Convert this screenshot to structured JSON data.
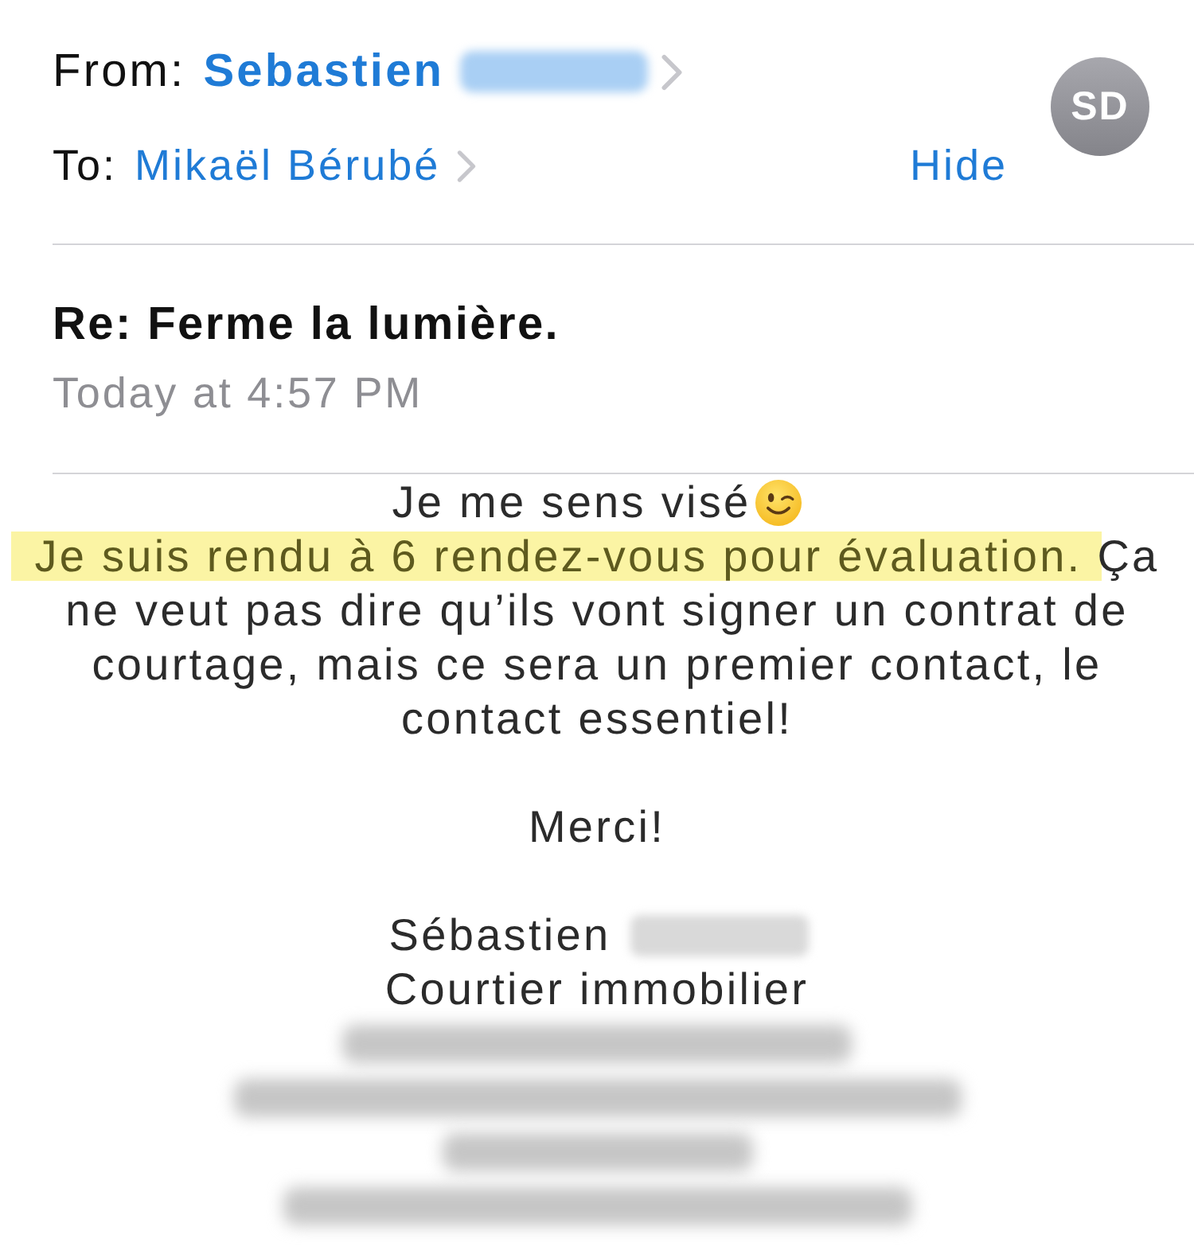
{
  "header": {
    "from": {
      "label": "From:",
      "name": "Sebastien",
      "surname_redacted": true
    },
    "to": {
      "label": "To:",
      "name": "Mikaël Bérubé"
    },
    "hide_button": "Hide",
    "avatar": {
      "initials": "SD"
    }
  },
  "subject": "Re: Ferme la lumière.",
  "date": "Today at 4:57 PM",
  "message": {
    "first_line": "Je me sens visé",
    "paragraph": [
      {
        "text": "Je suis rendu à 6 rendez-vous pour évaluation.",
        "highlighted": true
      },
      {
        "text": "Ça ne veut pas dire qu’ils vont signer un contrat de courtage, mais ce sera un premier contact, le contact essentiel!",
        "highlighted": false
      }
    ],
    "closing": "Merci!"
  },
  "signature": {
    "name": "Sébastien",
    "surname_redacted": true,
    "title": "Courtier immobilier",
    "details": [
      {
        "redacted": true
      },
      {
        "redacted": true
      },
      {
        "redacted": true
      },
      {
        "redacted": true
      }
    ]
  }
}
